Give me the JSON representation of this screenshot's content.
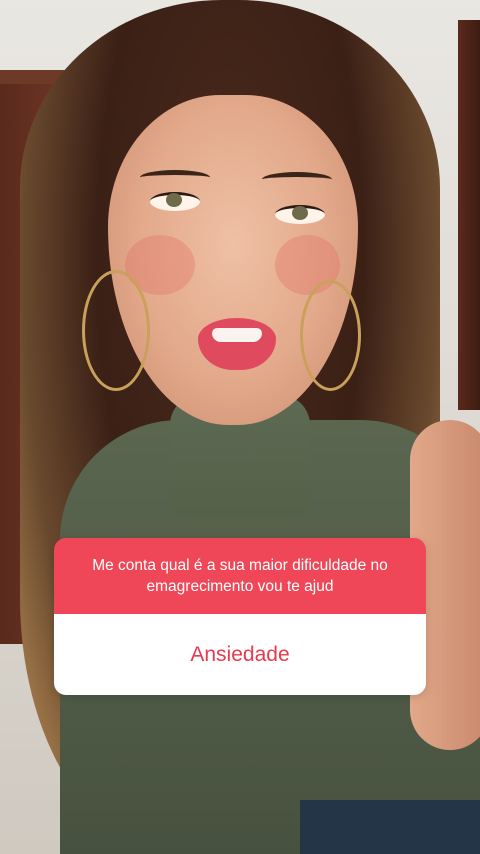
{
  "story": {
    "question_sticker": {
      "question": "Me conta qual é a sua maior dificuldade no emagrecimento vou te ajud",
      "answer": "Ansiedade",
      "header_color": "#ef4757",
      "answer_color": "#e8394f"
    }
  }
}
